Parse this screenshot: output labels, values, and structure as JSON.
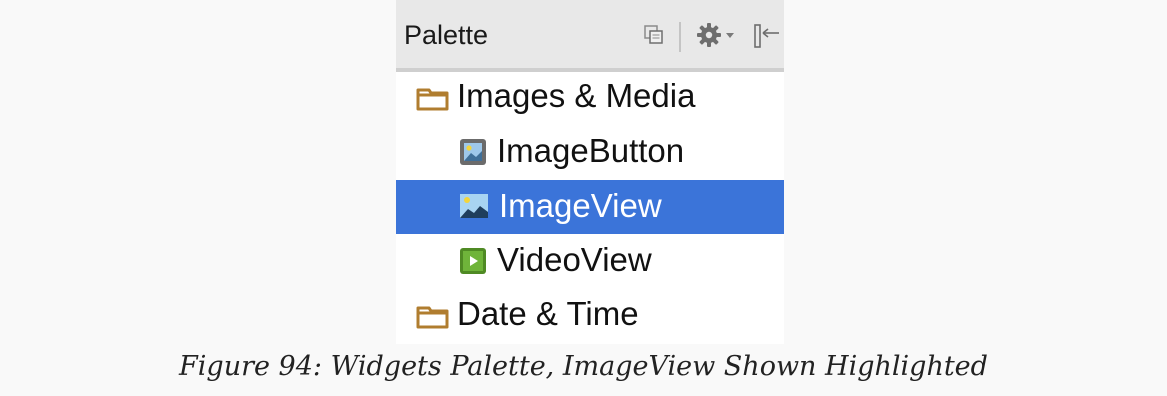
{
  "palette": {
    "title": "Palette",
    "header_icons": [
      "restore-icon",
      "gear-icon",
      "chevron-down-icon",
      "collapse-left-icon"
    ],
    "items": [
      {
        "label": "Images & Media",
        "kind": "category",
        "icon": "folder-icon",
        "selected": false
      },
      {
        "label": "ImageButton",
        "kind": "widget",
        "icon": "image-button-icon",
        "selected": false
      },
      {
        "label": "ImageView",
        "kind": "widget",
        "icon": "image-view-icon",
        "selected": true
      },
      {
        "label": "VideoView",
        "kind": "widget",
        "icon": "video-view-icon",
        "selected": false
      },
      {
        "label": "Date & Time",
        "kind": "category",
        "icon": "folder-icon",
        "selected": false
      }
    ]
  },
  "caption": "Figure 94: Widgets Palette, ImageView Shown Highlighted",
  "colors": {
    "selection": "#3b74d9",
    "folder": "#b07d2f",
    "video": "#5f9e2a"
  }
}
